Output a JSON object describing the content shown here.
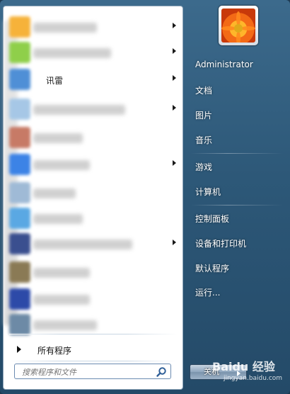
{
  "programs": [
    {
      "label": "",
      "has_arrow": true,
      "icon_color": "#f6b23a",
      "blur_width": 90
    },
    {
      "label": "",
      "has_arrow": true,
      "icon_color": "#8fcf4a",
      "blur_width": 110
    },
    {
      "label": "讯雷",
      "has_arrow": true,
      "icon_color": "#4f8fd6",
      "blur_width": 0
    },
    {
      "label": "",
      "has_arrow": true,
      "icon_color": "#a6c7e6",
      "blur_width": 130
    },
    {
      "label": "",
      "has_arrow": false,
      "icon_color": "#c77a66",
      "blur_width": 70
    },
    {
      "label": "",
      "has_arrow": true,
      "icon_color": "#3c83e6",
      "blur_width": 80
    },
    {
      "label": "",
      "has_arrow": false,
      "icon_color": "#9fbad6",
      "blur_width": 60
    },
    {
      "label": "",
      "has_arrow": false,
      "icon_color": "#5aa8e3",
      "blur_width": 70
    },
    {
      "label": "",
      "has_arrow": true,
      "icon_color": "#3a4f8f",
      "blur_width": 140
    },
    {
      "label": "",
      "has_arrow": false,
      "icon_color": "#8a7a55",
      "blur_width": 80
    },
    {
      "label": "",
      "has_arrow": false,
      "icon_color": "#2d4aa8",
      "blur_width": 80
    },
    {
      "label": "",
      "has_arrow": false,
      "icon_color": "#6d8aa6",
      "blur_width": 90
    }
  ],
  "all_programs": "所有程序",
  "search": {
    "placeholder": "搜索程序和文件"
  },
  "user": {
    "name": "Administrator"
  },
  "right_items": [
    "文档",
    "图片",
    "音乐",
    "游戏",
    "计算机",
    "控制面板",
    "设备和打印机",
    "默认程序",
    "运行..."
  ],
  "shutdown": {
    "label": "关机"
  },
  "watermark": {
    "brand": "Baidu 经验",
    "sub": "jingyan.baidu.com"
  },
  "colors": {
    "menu_bg": "#2d5878",
    "left_bg": "#ffffff",
    "accent": "#3c6a8c"
  }
}
